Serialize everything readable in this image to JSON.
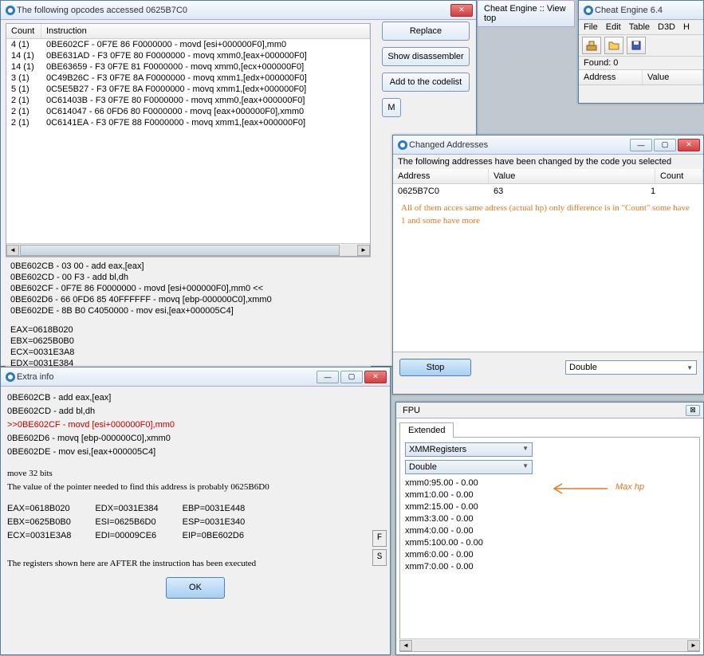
{
  "bg_tabs": {
    "topics": "Cheat Engine :: View top"
  },
  "opcodes_win": {
    "title": "The following opcodes accessed 0625B7C0",
    "columns": [
      "Count",
      "Instruction"
    ],
    "rows": [
      {
        "count": "4 (1)",
        "instr": "0BE602CF - 0F7E 86 F0000000  - movd [esi+000000F0],mm0"
      },
      {
        "count": "14 (1)",
        "instr": "0BE631AD - F3 0F7E 80 F0000000  - movq xmm0,[eax+000000F0]"
      },
      {
        "count": "14 (1)",
        "instr": "0BE63659 - F3 0F7E 81 F0000000  - movq xmm0,[ecx+000000F0]"
      },
      {
        "count": "3 (1)",
        "instr": "0C49B26C - F3 0F7E 8A F0000000  - movq xmm1,[edx+000000F0]"
      },
      {
        "count": "5 (1)",
        "instr": "0C5E5B27 - F3 0F7E 8A F0000000  - movq xmm1,[edx+000000F0]"
      },
      {
        "count": "2 (1)",
        "instr": "0C61403B - F3 0F7E 80 F0000000  - movq xmm0,[eax+000000F0]"
      },
      {
        "count": "2 (1)",
        "instr": "0C614047 - 66 0FD6 80 F0000000  - movq [eax+000000F0],xmm0"
      },
      {
        "count": "2 (1)",
        "instr": "0C6141EA - F3 0F7E 88 F0000000  - movq xmm1,[eax+000000F0]"
      }
    ],
    "buttons": {
      "replace": "Replace",
      "show_disasm": "Show disassembler",
      "add_codelist": "Add to the codelist",
      "m_partial": "M"
    },
    "asm_lines": [
      "0BE602CB - 03 00  - add eax,[eax]",
      "0BE602CD - 00 F3  - add bl,dh",
      "0BE602CF - 0F7E 86 F0000000  - movd [esi+000000F0],mm0 <<",
      "0BE602D6 - 66 0FD6 85 40FFFFFF  - movq [ebp-000000C0],xmm0",
      "0BE602DE - 8B B0 C4050000  - mov esi,[eax+000005C4]"
    ],
    "regs": [
      "EAX=0618B020",
      "EBX=0625B0B0",
      "ECX=0031E3A8",
      "EDX=0031E384"
    ]
  },
  "extra_win": {
    "title": "Extra info",
    "lines": [
      "  0BE602CB - add eax,[eax]",
      "  0BE602CD - add bl,dh",
      ">>0BE602CF - movd [esi+000000F0],mm0",
      "  0BE602D6 - movq [ebp-000000C0],xmm0",
      "  0BE602DE - mov esi,[eax+000005C4]"
    ],
    "note1": "move 32 bits",
    "note2": "The value of the pointer needed to find this address is probably 0625B6D0",
    "regs": {
      "c1": [
        "EAX=0618B020",
        "EBX=0625B0B0",
        "ECX=0031E3A8"
      ],
      "c2": [
        "EDX=0031E384",
        "ESI=0625B6D0",
        "EDI=00009CE6"
      ],
      "c3": [
        "EBP=0031E448",
        "ESP=0031E340",
        "EIP=0BE602D6"
      ]
    },
    "f": "F",
    "s": "S",
    "footer": "The registers shown here are AFTER the instruction has been executed",
    "ok": "OK"
  },
  "changed_win": {
    "title": "Changed Addresses",
    "desc": "The following addresses have been changed by the code you selected",
    "columns": [
      "Address",
      "Value",
      "Count"
    ],
    "rows": [
      {
        "a": "0625B7C0",
        "v": "63",
        "c": "1"
      }
    ],
    "annot": "All of them acces same adress (actual hp) only difference is in \"Count\" some have 1 and some have more",
    "stop": "Stop",
    "type": "Double"
  },
  "fpu_win": {
    "title": "FPU",
    "tab": "Extended",
    "combo1": "XMMRegisters",
    "combo2": "Double",
    "xmm": [
      "xmm0:95.00 - 0.00",
      "xmm1:0.00 - 0.00",
      "xmm2:15.00 - 0.00",
      "xmm3:3.00 - 0.00",
      "xmm4:0.00 - 0.00",
      "xmm5:100.00 - 0.00",
      "xmm6:0.00 - 0.00",
      "xmm7:0.00 - 0.00"
    ],
    "annot": "Max hp"
  },
  "ce_main": {
    "title": "Cheat Engine 6.4",
    "menu": [
      "File",
      "Edit",
      "Table",
      "D3D",
      "H"
    ],
    "found": "Found: 0",
    "columns": [
      "Address",
      "Value"
    ]
  }
}
